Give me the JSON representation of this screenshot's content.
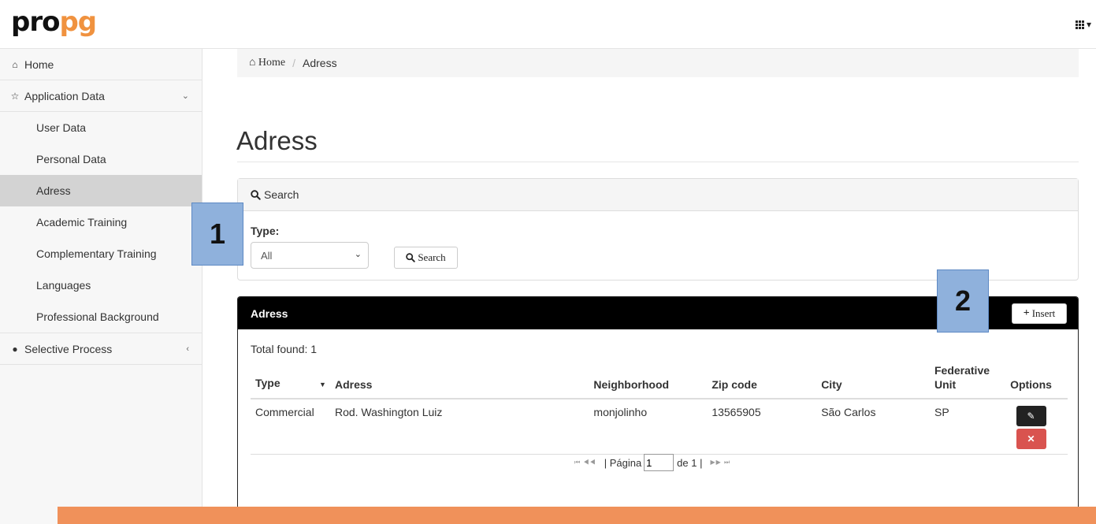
{
  "app": {
    "logo_left": "pro",
    "logo_right": "pg"
  },
  "header": {
    "apps_icon": "grid-icon",
    "apps_caret": "▾"
  },
  "sidebar": {
    "home": "Home",
    "application_data": "Application Data",
    "sub_items": [
      "User Data",
      "Personal Data",
      "Adress",
      "Academic Training",
      "Complementary Training",
      "Languages",
      "Professional Background"
    ],
    "selective_process": "Selective Process",
    "active_item": "Adress"
  },
  "breadcrumb": {
    "home": "Home",
    "current": "Adress"
  },
  "page": {
    "title": "Adress"
  },
  "search_panel": {
    "heading": "Search",
    "type_label": "Type:",
    "type_value": "All",
    "search_button": "Search"
  },
  "callouts": {
    "one": "1",
    "two": "2"
  },
  "adress_panel": {
    "heading": "Adress",
    "insert_button": "Insert",
    "total": "Total found: 1",
    "columns": [
      "Type",
      "Adress",
      "Neighborhood",
      "Zip code",
      "City",
      "Federative Unit",
      "Options"
    ],
    "rows": [
      {
        "type": "Commercial",
        "adress": "Rod. Washington Luiz",
        "neighborhood": "monjolinho",
        "zip": "13565905",
        "city": "São Carlos",
        "uf": "SP"
      }
    ]
  },
  "pager": {
    "first_prev": "⏮ ◀◀",
    "page_label": "| Página",
    "page_value": "1",
    "of_label": "de 1 |",
    "next_last": "▶▶ ⏭"
  },
  "colors": {
    "accent_orange": "#f0915a",
    "callout_blue": "#8fb1dc",
    "delete_red": "#d9534f"
  }
}
